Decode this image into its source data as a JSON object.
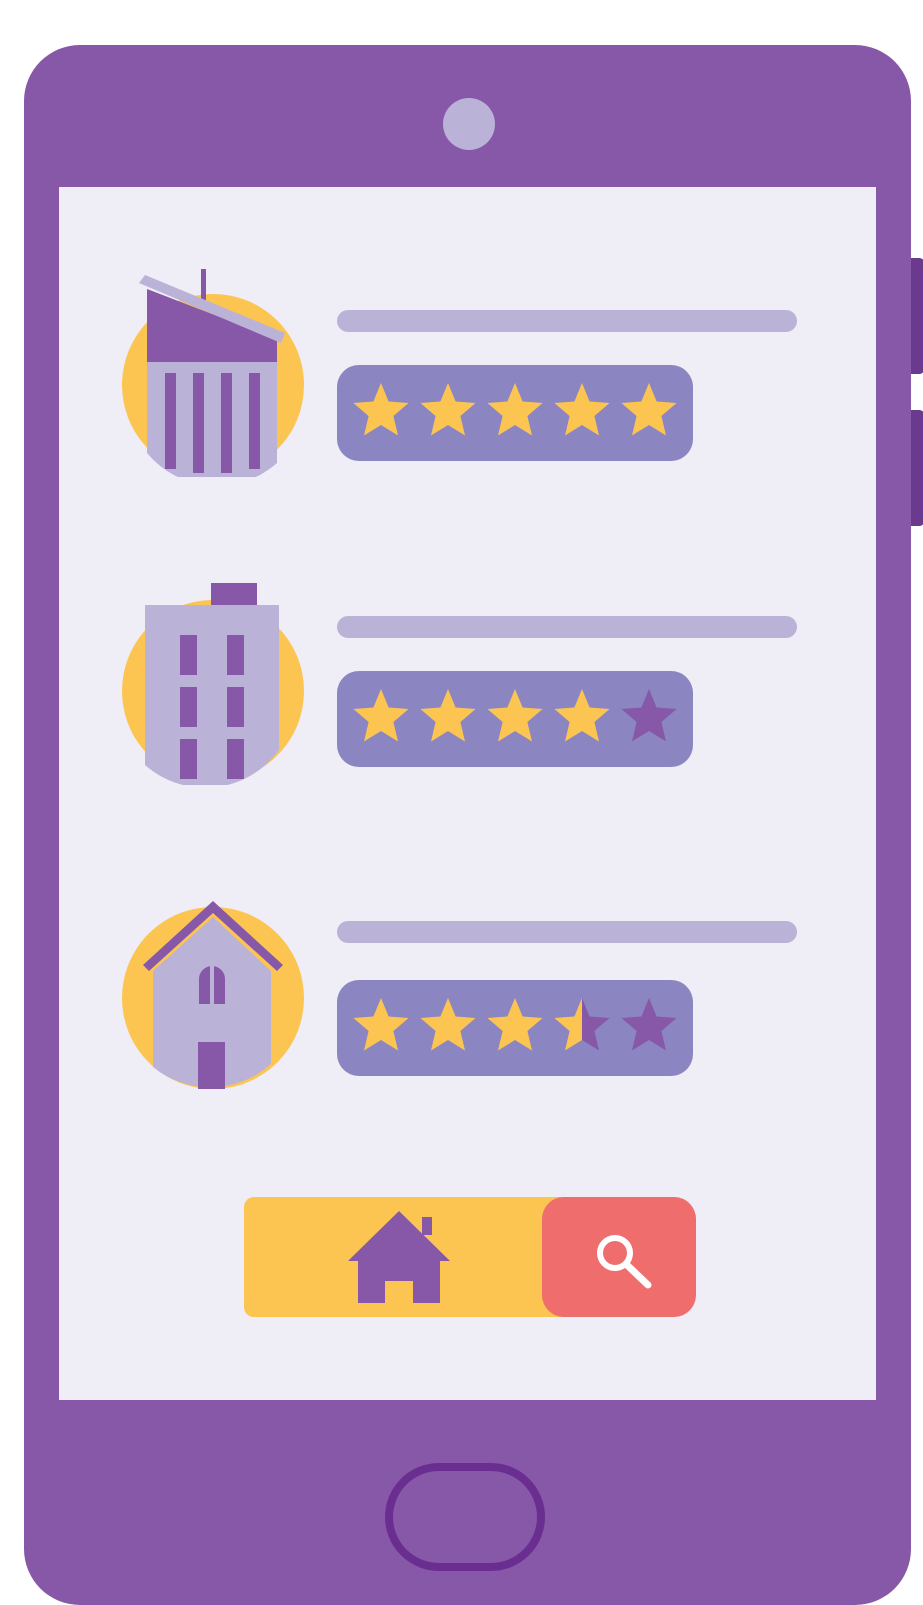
{
  "colors": {
    "phone_body": "#8658a7",
    "screen": "#efedf5",
    "accent_yellow": "#fcc552",
    "rating_bg": "#8b86c2",
    "text_placeholder": "#bbb2d8",
    "search_red": "#ef6d6d",
    "star_filled": "#fcc552",
    "star_empty": "#8658a7"
  },
  "listings": [
    {
      "icon": "office-building-icon",
      "rating": 5,
      "max_rating": 5
    },
    {
      "icon": "apartment-building-icon",
      "rating": 4,
      "max_rating": 5
    },
    {
      "icon": "house-icon",
      "rating": 3.5,
      "max_rating": 5
    }
  ],
  "nav": {
    "home_icon": "home-icon",
    "search_icon": "search-icon"
  }
}
